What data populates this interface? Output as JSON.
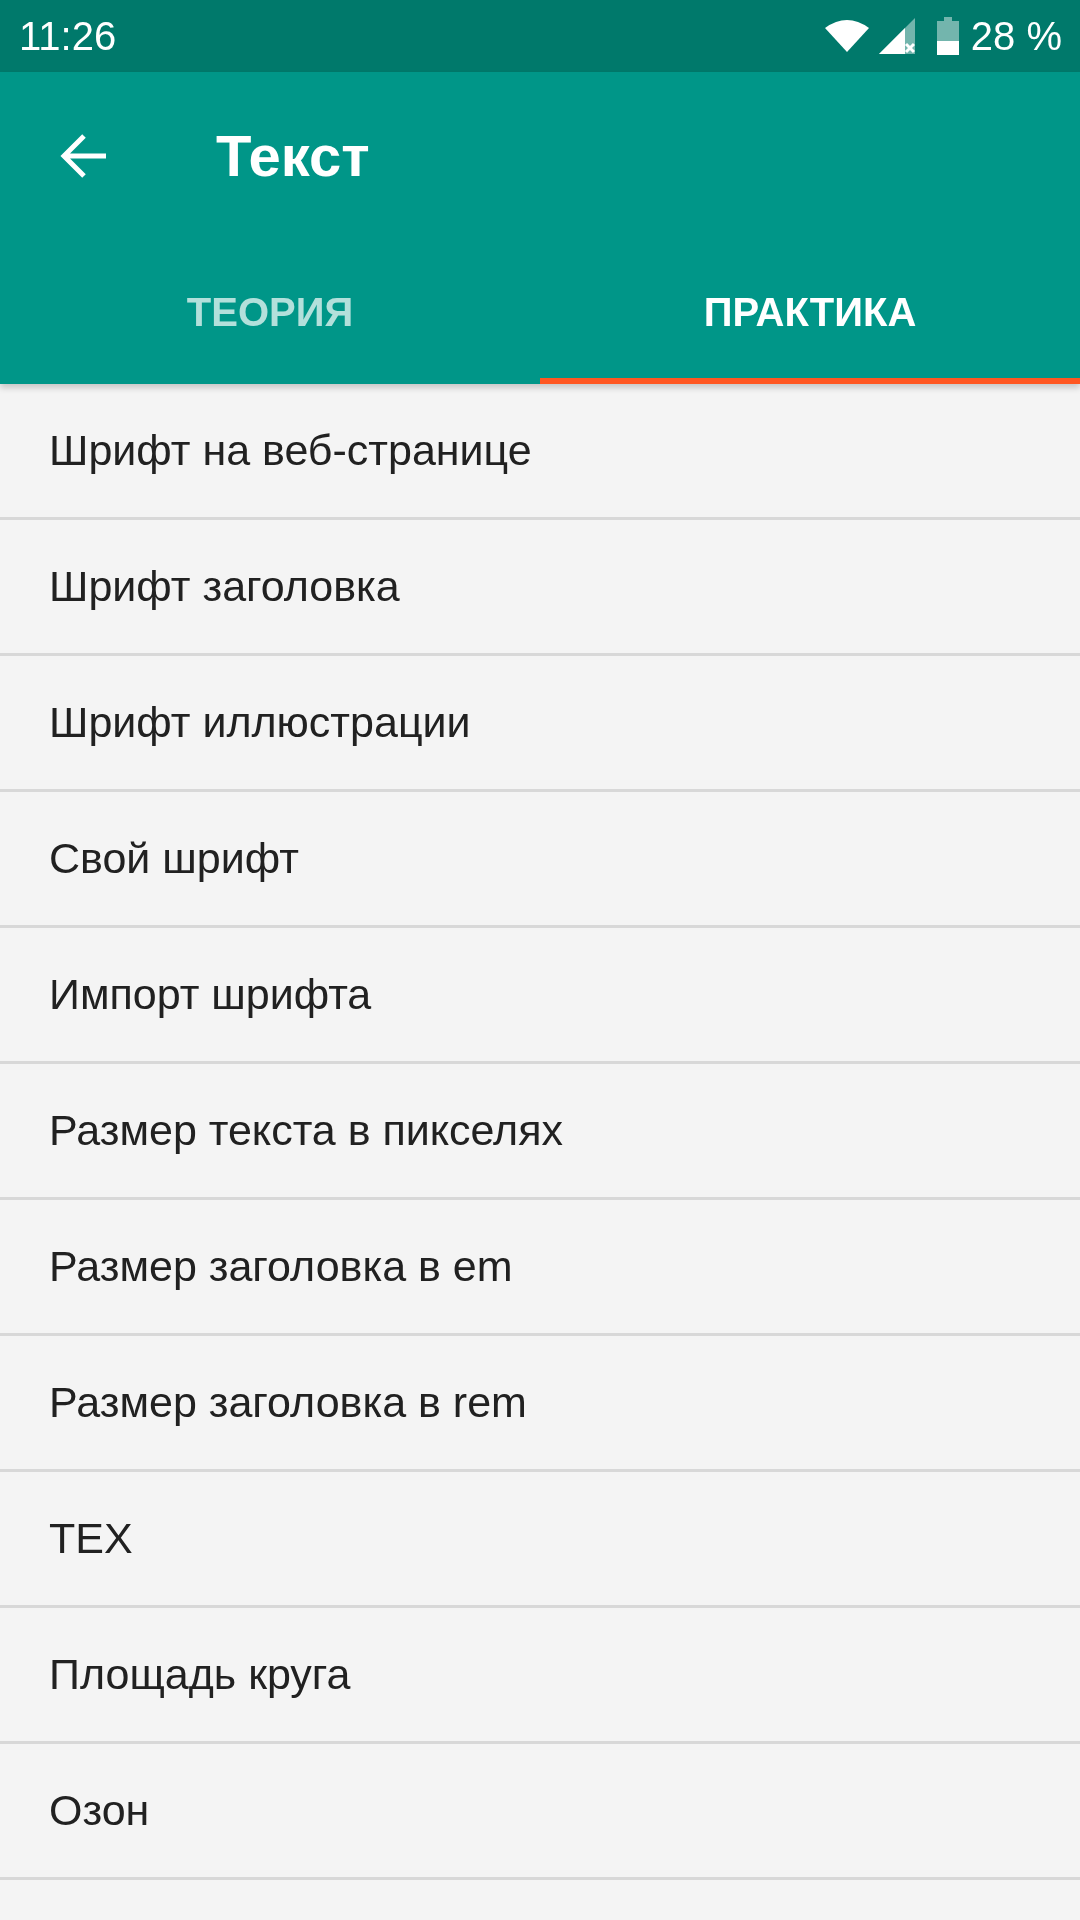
{
  "status_bar": {
    "time": "11:26",
    "battery_text": "28 %"
  },
  "app_bar": {
    "title": "Текст"
  },
  "tabs": [
    {
      "label": "ТЕОРИЯ",
      "selected": false
    },
    {
      "label": "ПРАКТИКА",
      "selected": true
    }
  ],
  "list": {
    "items": [
      {
        "label": "Шрифт на веб-странице"
      },
      {
        "label": "Шрифт заголовка"
      },
      {
        "label": "Шрифт иллюстрации"
      },
      {
        "label": "Свой шрифт"
      },
      {
        "label": "Импорт шрифта"
      },
      {
        "label": "Размер текста в пикселях"
      },
      {
        "label": "Размер заголовка в em"
      },
      {
        "label": "Размер заголовка в rem"
      },
      {
        "label": "TEX"
      },
      {
        "label": "Площадь круга"
      },
      {
        "label": "Озон"
      }
    ]
  }
}
